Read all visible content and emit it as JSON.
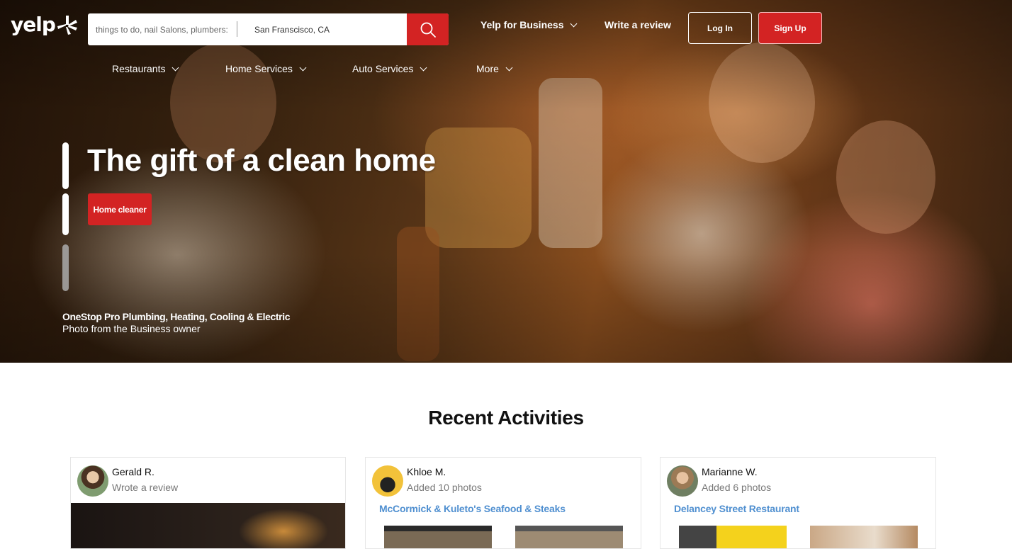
{
  "header": {
    "logo_text": "yelp",
    "search": {
      "find_placeholder": "things to do, nail Salons, plumbers:",
      "near_value": "San Franscisco, CA"
    },
    "links": {
      "business": "Yelp for Business",
      "write_review": "Write a review"
    },
    "login_label": "Log In",
    "signup_label": "Sign Up"
  },
  "categories": [
    "Restaurants",
    "Home Services",
    "Auto Services",
    "More"
  ],
  "hero": {
    "title": "The gift of a clean home",
    "button_label": "Home cleaner",
    "credit_name": "OneStop Pro Plumbing, Heating, Cooling & Electric",
    "credit_sub": "Photo from the Business owner"
  },
  "recent": {
    "title": "Recent Activities",
    "cards": [
      {
        "name": "Gerald R.",
        "action": "Wrote a review",
        "business": ""
      },
      {
        "name": "Khloe M.",
        "action": "Added 10 photos",
        "business": "McCormick & Kuleto's Seafood & Steaks"
      },
      {
        "name": "Marianne W.",
        "action": "Added 6 photos",
        "business": "Delancey Street Restaurant"
      }
    ]
  },
  "colors": {
    "brand_red": "#d32323",
    "link_blue": "#4f8fd0"
  },
  "icons": {
    "logo": "yelp-burst-icon",
    "search": "search-icon",
    "dropdown": "chevron-down-icon"
  }
}
